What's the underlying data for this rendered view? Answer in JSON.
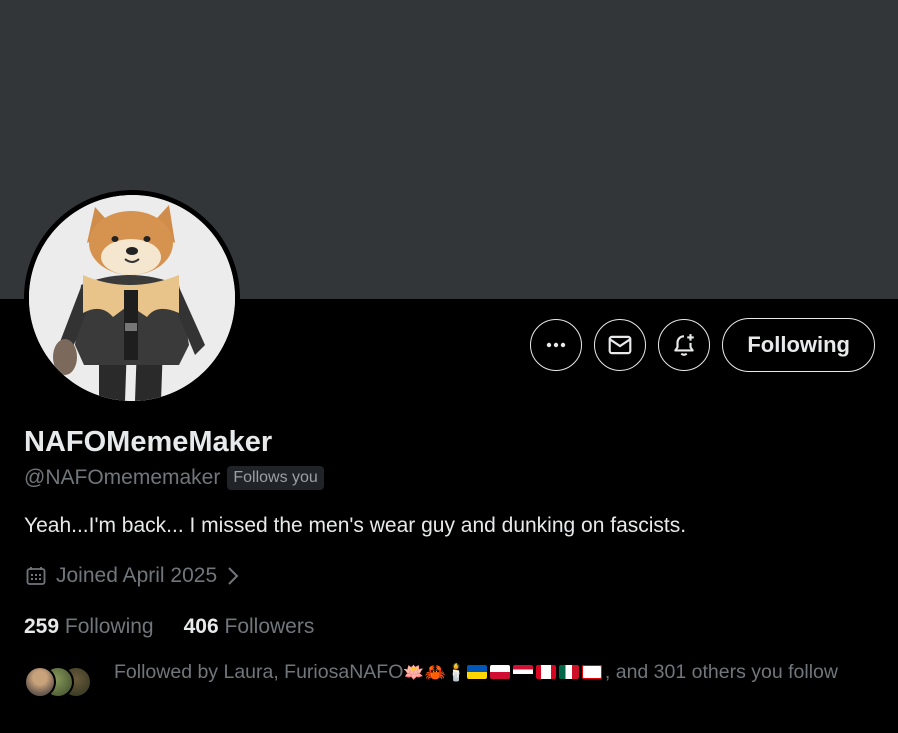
{
  "profile": {
    "display_name": "NAFOMemeMaker",
    "handle": "@NAFOmememaker",
    "follows_you_badge": "Follows you",
    "bio": "Yeah...I'm back... I missed the men's wear guy and dunking on fascists.",
    "joined": "Joined April 2025"
  },
  "actions": {
    "more_label": "More",
    "message_label": "Message",
    "notify_label": "Turn on notifications",
    "following_label": "Following"
  },
  "stats": {
    "following_count": "259",
    "following_label": "Following",
    "followers_count": "406",
    "followers_label": "Followers"
  },
  "followed_by": {
    "prefix": "Followed by Laura, FuriosaNAFO",
    "emoji": "🪷🦀🕯️",
    "suffix": ", and 301 others you follow"
  },
  "colors": {
    "banner": "#333639",
    "background": "#000000",
    "primary_text": "#e7e9ea",
    "secondary_text": "#71767b"
  },
  "icons": [
    "more-icon",
    "mail-icon",
    "bell-plus-icon",
    "calendar-icon",
    "chevron-right-icon"
  ]
}
